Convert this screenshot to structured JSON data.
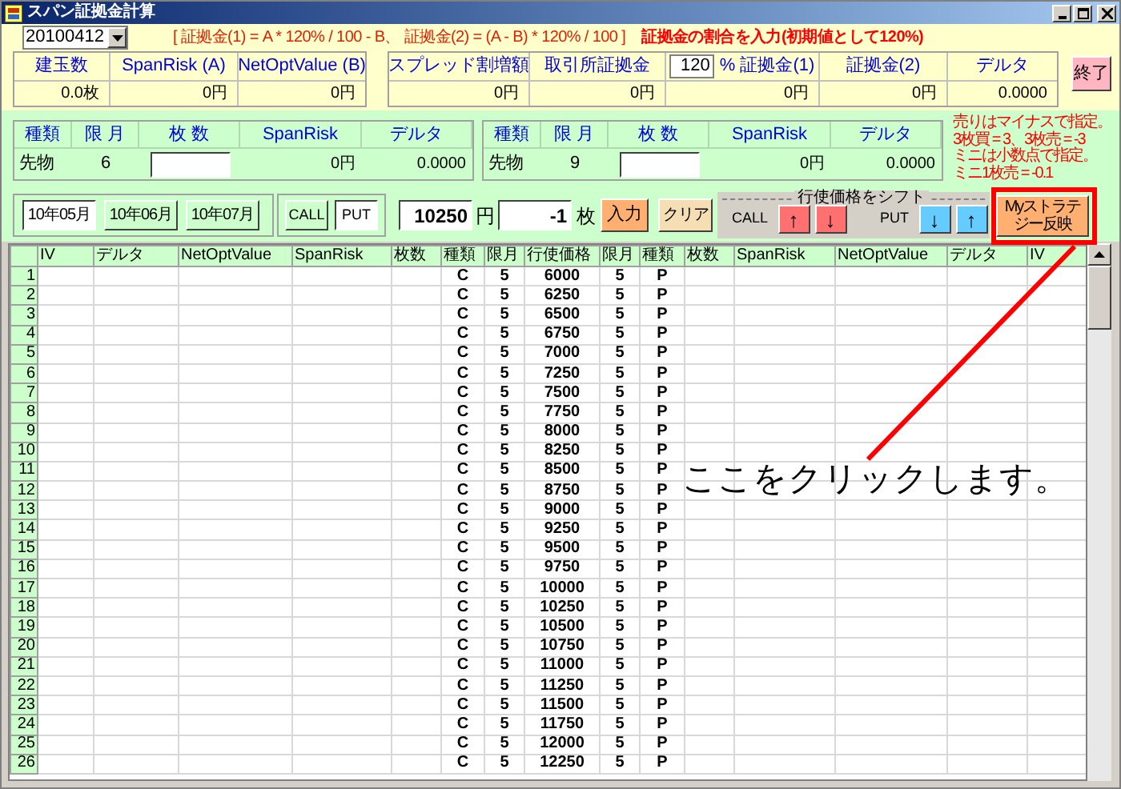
{
  "window": {
    "title": "スパン証拠金計算"
  },
  "date_select": {
    "value": "20100412"
  },
  "formula": "[ 証拠金(1) = A * 120% / 100 - B、 証拠金(2) = (A - B) * 120% / 100 ]",
  "ratio_hint": "証拠金の割合を入力(初期値として120%)",
  "summary_left": [
    {
      "label": "建玉数",
      "value": "0.0枚"
    },
    {
      "label": "SpanRisk (A)",
      "value": "0円"
    },
    {
      "label": "NetOptValue (B)",
      "value": "0円"
    }
  ],
  "summary_right": [
    {
      "label": "スプレッド割増額",
      "value": "0円"
    },
    {
      "label": "取引所証拠金",
      "value": "0円"
    },
    {
      "label": "% 証拠金(1)",
      "input": "120",
      "value": "0円"
    },
    {
      "label": "証拠金(2)",
      "value": "0円"
    },
    {
      "label": "デルタ",
      "value": "0.0000"
    }
  ],
  "exit_button": "終了",
  "futures": [
    {
      "headers": [
        "種類",
        "限 月",
        "枚 数",
        "SpanRisk",
        "デルタ"
      ],
      "type": "先物",
      "month": "6",
      "span_risk": "0円",
      "delta": "0.0000"
    },
    {
      "headers": [
        "種類",
        "限 月",
        "枚 数",
        "SpanRisk",
        "デルタ"
      ],
      "type": "先物",
      "month": "9",
      "span_risk": "0円",
      "delta": "0.0000"
    }
  ],
  "note": [
    "売りはマイナスで指定。",
    "3枚買 = 3、3枚売 = -3",
    "ミニは小数点で指定。",
    "ミニ1枚売 = -0.1"
  ],
  "month_buttons": [
    {
      "label": "10年05月",
      "selected": true
    },
    {
      "label": "10年06月",
      "selected": false
    },
    {
      "label": "10年07月",
      "selected": false
    }
  ],
  "option_type": [
    {
      "label": "CALL",
      "selected": false
    },
    {
      "label": "PUT",
      "selected": true
    }
  ],
  "price": {
    "value": "10250",
    "unit": "円"
  },
  "quantity": {
    "value": "-1",
    "unit": "枚"
  },
  "enter_button": "入力",
  "clear_button": "クリア",
  "shift_group": {
    "title": "行使価格をシフト",
    "call_label": "CALL",
    "call_buttons": [
      "↑",
      "↓"
    ],
    "put_label": "PUT",
    "put_buttons": [
      "↓",
      "↑"
    ]
  },
  "strategy_button": {
    "lines": [
      "Myストラテ",
      "ジー反映"
    ]
  },
  "table": {
    "columns": [
      "IV",
      "デルタ",
      "NetOptValue",
      "SpanRisk",
      "枚数",
      "種類",
      "限月",
      "行使価格",
      "限月",
      "種類",
      "枚数",
      "SpanRisk",
      "NetOptValue",
      "デルタ",
      "IV"
    ],
    "rows": [
      {
        "no": "1",
        "call_type": "C",
        "call_month": "5",
        "strike": "6000",
        "put_month": "5",
        "put_type": "P"
      },
      {
        "no": "2",
        "call_type": "C",
        "call_month": "5",
        "strike": "6250",
        "put_month": "5",
        "put_type": "P"
      },
      {
        "no": "3",
        "call_type": "C",
        "call_month": "5",
        "strike": "6500",
        "put_month": "5",
        "put_type": "P"
      },
      {
        "no": "4",
        "call_type": "C",
        "call_month": "5",
        "strike": "6750",
        "put_month": "5",
        "put_type": "P"
      },
      {
        "no": "5",
        "call_type": "C",
        "call_month": "5",
        "strike": "7000",
        "put_month": "5",
        "put_type": "P"
      },
      {
        "no": "6",
        "call_type": "C",
        "call_month": "5",
        "strike": "7250",
        "put_month": "5",
        "put_type": "P"
      },
      {
        "no": "7",
        "call_type": "C",
        "call_month": "5",
        "strike": "7500",
        "put_month": "5",
        "put_type": "P"
      },
      {
        "no": "8",
        "call_type": "C",
        "call_month": "5",
        "strike": "7750",
        "put_month": "5",
        "put_type": "P"
      },
      {
        "no": "9",
        "call_type": "C",
        "call_month": "5",
        "strike": "8000",
        "put_month": "5",
        "put_type": "P"
      },
      {
        "no": "10",
        "call_type": "C",
        "call_month": "5",
        "strike": "8250",
        "put_month": "5",
        "put_type": "P"
      },
      {
        "no": "11",
        "call_type": "C",
        "call_month": "5",
        "strike": "8500",
        "put_month": "5",
        "put_type": "P"
      },
      {
        "no": "12",
        "call_type": "C",
        "call_month": "5",
        "strike": "8750",
        "put_month": "5",
        "put_type": "P"
      },
      {
        "no": "13",
        "call_type": "C",
        "call_month": "5",
        "strike": "9000",
        "put_month": "5",
        "put_type": "P"
      },
      {
        "no": "14",
        "call_type": "C",
        "call_month": "5",
        "strike": "9250",
        "put_month": "5",
        "put_type": "P"
      },
      {
        "no": "15",
        "call_type": "C",
        "call_month": "5",
        "strike": "9500",
        "put_month": "5",
        "put_type": "P"
      },
      {
        "no": "16",
        "call_type": "C",
        "call_month": "5",
        "strike": "9750",
        "put_month": "5",
        "put_type": "P"
      },
      {
        "no": "17",
        "call_type": "C",
        "call_month": "5",
        "strike": "10000",
        "put_month": "5",
        "put_type": "P"
      },
      {
        "no": "18",
        "call_type": "C",
        "call_month": "5",
        "strike": "10250",
        "put_month": "5",
        "put_type": "P"
      },
      {
        "no": "19",
        "call_type": "C",
        "call_month": "5",
        "strike": "10500",
        "put_month": "5",
        "put_type": "P"
      },
      {
        "no": "20",
        "call_type": "C",
        "call_month": "5",
        "strike": "10750",
        "put_month": "5",
        "put_type": "P"
      },
      {
        "no": "21",
        "call_type": "C",
        "call_month": "5",
        "strike": "11000",
        "put_month": "5",
        "put_type": "P"
      },
      {
        "no": "22",
        "call_type": "C",
        "call_month": "5",
        "strike": "11250",
        "put_month": "5",
        "put_type": "P"
      },
      {
        "no": "23",
        "call_type": "C",
        "call_month": "5",
        "strike": "11500",
        "put_month": "5",
        "put_type": "P"
      },
      {
        "no": "24",
        "call_type": "C",
        "call_month": "5",
        "strike": "11750",
        "put_month": "5",
        "put_type": "P"
      },
      {
        "no": "25",
        "call_type": "C",
        "call_month": "5",
        "strike": "12000",
        "put_month": "5",
        "put_type": "P"
      },
      {
        "no": "26",
        "call_type": "C",
        "call_month": "5",
        "strike": "12250",
        "put_month": "5",
        "put_type": "P"
      }
    ]
  },
  "annotation": {
    "text": "ここをクリックします。"
  }
}
